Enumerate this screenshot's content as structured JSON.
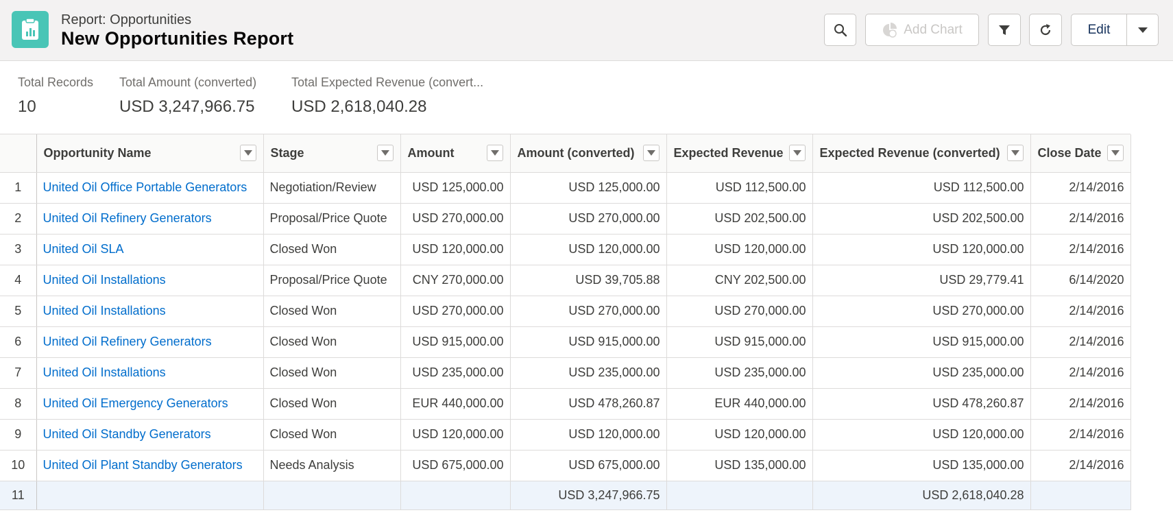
{
  "header": {
    "eyebrow": "Report: Opportunities",
    "title": "New Opportunities Report",
    "buttons": {
      "add_chart": "Add Chart",
      "edit": "Edit"
    }
  },
  "summary": [
    {
      "label": "Total Records",
      "value": "10"
    },
    {
      "label": "Total Amount (converted)",
      "value": "USD 3,247,966.75"
    },
    {
      "label": "Total Expected Revenue (convert...",
      "value": "USD 2,618,040.28"
    }
  ],
  "table": {
    "columns": [
      "Opportunity Name",
      "Stage",
      "Amount",
      "Amount (converted)",
      "Expected Revenue",
      "Expected Revenue (converted)",
      "Close Date"
    ],
    "rows": [
      {
        "n": "1",
        "name": "United Oil Office Portable Generators",
        "stage": "Negotiation/Review",
        "amount": "USD 125,000.00",
        "amount_conv": "USD 125,000.00",
        "exp_rev": "USD 112,500.00",
        "exp_rev_conv": "USD 112,500.00",
        "close": "2/14/2016"
      },
      {
        "n": "2",
        "name": "United Oil Refinery Generators",
        "stage": "Proposal/Price Quote",
        "amount": "USD 270,000.00",
        "amount_conv": "USD 270,000.00",
        "exp_rev": "USD 202,500.00",
        "exp_rev_conv": "USD 202,500.00",
        "close": "2/14/2016"
      },
      {
        "n": "3",
        "name": "United Oil SLA",
        "stage": "Closed Won",
        "amount": "USD 120,000.00",
        "amount_conv": "USD 120,000.00",
        "exp_rev": "USD 120,000.00",
        "exp_rev_conv": "USD 120,000.00",
        "close": "2/14/2016"
      },
      {
        "n": "4",
        "name": "United Oil Installations",
        "stage": "Proposal/Price Quote",
        "amount": "CNY 270,000.00",
        "amount_conv": "USD 39,705.88",
        "exp_rev": "CNY 202,500.00",
        "exp_rev_conv": "USD 29,779.41",
        "close": "6/14/2020"
      },
      {
        "n": "5",
        "name": "United Oil Installations",
        "stage": "Closed Won",
        "amount": "USD 270,000.00",
        "amount_conv": "USD 270,000.00",
        "exp_rev": "USD 270,000.00",
        "exp_rev_conv": "USD 270,000.00",
        "close": "2/14/2016"
      },
      {
        "n": "6",
        "name": "United Oil Refinery Generators",
        "stage": "Closed Won",
        "amount": "USD 915,000.00",
        "amount_conv": "USD 915,000.00",
        "exp_rev": "USD 915,000.00",
        "exp_rev_conv": "USD 915,000.00",
        "close": "2/14/2016"
      },
      {
        "n": "7",
        "name": "United Oil Installations",
        "stage": "Closed Won",
        "amount": "USD 235,000.00",
        "amount_conv": "USD 235,000.00",
        "exp_rev": "USD 235,000.00",
        "exp_rev_conv": "USD 235,000.00",
        "close": "2/14/2016"
      },
      {
        "n": "8",
        "name": "United Oil Emergency Generators",
        "stage": "Closed Won",
        "amount": "EUR 440,000.00",
        "amount_conv": "USD 478,260.87",
        "exp_rev": "EUR 440,000.00",
        "exp_rev_conv": "USD 478,260.87",
        "close": "2/14/2016"
      },
      {
        "n": "9",
        "name": "United Oil Standby Generators",
        "stage": "Closed Won",
        "amount": "USD 120,000.00",
        "amount_conv": "USD 120,000.00",
        "exp_rev": "USD 120,000.00",
        "exp_rev_conv": "USD 120,000.00",
        "close": "2/14/2016"
      },
      {
        "n": "10",
        "name": "United Oil Plant Standby Generators",
        "stage": "Needs Analysis",
        "amount": "USD 675,000.00",
        "amount_conv": "USD 675,000.00",
        "exp_rev": "USD 135,000.00",
        "exp_rev_conv": "USD 135,000.00",
        "close": "2/14/2016"
      }
    ],
    "total_row": {
      "n": "11",
      "amount_conv": "USD 3,247,966.75",
      "exp_rev_conv": "USD 2,618,040.28"
    }
  },
  "colors": {
    "accent": "#49c5b6",
    "link": "#006dcc",
    "header_bg": "#f3f2f2",
    "total_row_bg": "#eef4fb"
  }
}
